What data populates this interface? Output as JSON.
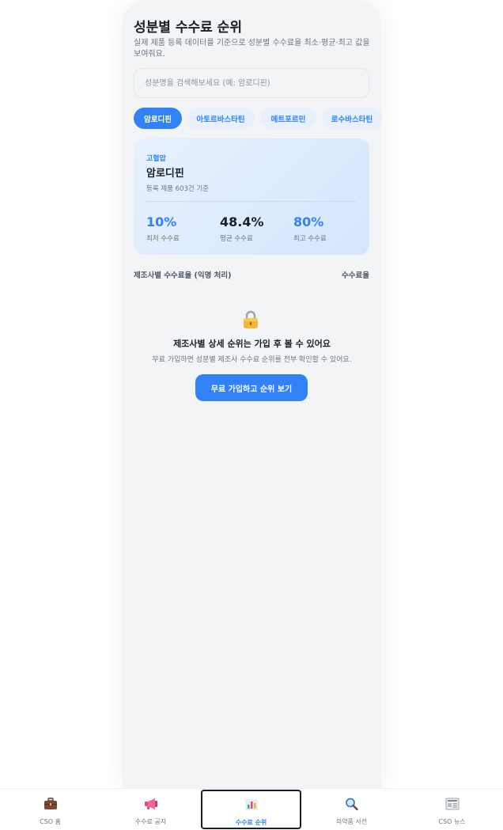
{
  "page": {
    "title": "성분별 수수료 순위",
    "description": "실제 제품 등록 데이터를 기준으로 성분별 수수료율 최소·평균·최고 값을 보여줘요."
  },
  "search": {
    "placeholder": "성분명을 검색해보세요 (예: 암로디핀)"
  },
  "chips": [
    {
      "label": "암로디핀",
      "active": true
    },
    {
      "label": "아토르바스타틴",
      "active": false
    },
    {
      "label": "메트포르민",
      "active": false
    },
    {
      "label": "로수바스타틴",
      "active": false
    }
  ],
  "card": {
    "category": "고혈압",
    "name": "암로디핀",
    "count_text": "등록 제품 603건 기준",
    "stats": [
      {
        "value": "10%",
        "label": "최저 수수료",
        "color": "#3182f6"
      },
      {
        "value": "48.4%",
        "label": "평균 수수료",
        "color": "#191f28"
      },
      {
        "value": "80%",
        "label": "최고 수수료",
        "color": "#3182f6"
      }
    ]
  },
  "section": {
    "left": "제조사별 수수료율 (익명 처리)",
    "right": "수수료율"
  },
  "locked": {
    "icon": "lock-icon",
    "title": "제조사별 상세 순위는 가입 후 볼 수 있어요",
    "description": "무료 가입하면 성분별 제조사 수수료 순위를 전부 확인할 수 있어요.",
    "cta": "무료 가입하고 순위 보기"
  },
  "nav": [
    {
      "label": "CSO 홈",
      "icon": "briefcase-icon",
      "active": false
    },
    {
      "label": "수수료 공지",
      "icon": "megaphone-icon",
      "active": false
    },
    {
      "label": "수수료 순위",
      "icon": "bar-chart-icon",
      "active": true
    },
    {
      "label": "의약품 사전",
      "icon": "magnifier-icon",
      "active": false
    },
    {
      "label": "CSO 뉴스",
      "icon": "newspaper-icon",
      "active": false
    }
  ],
  "colors": {
    "accent": "#3182f6",
    "background": "#f2f4f6",
    "text": "#191f28"
  }
}
